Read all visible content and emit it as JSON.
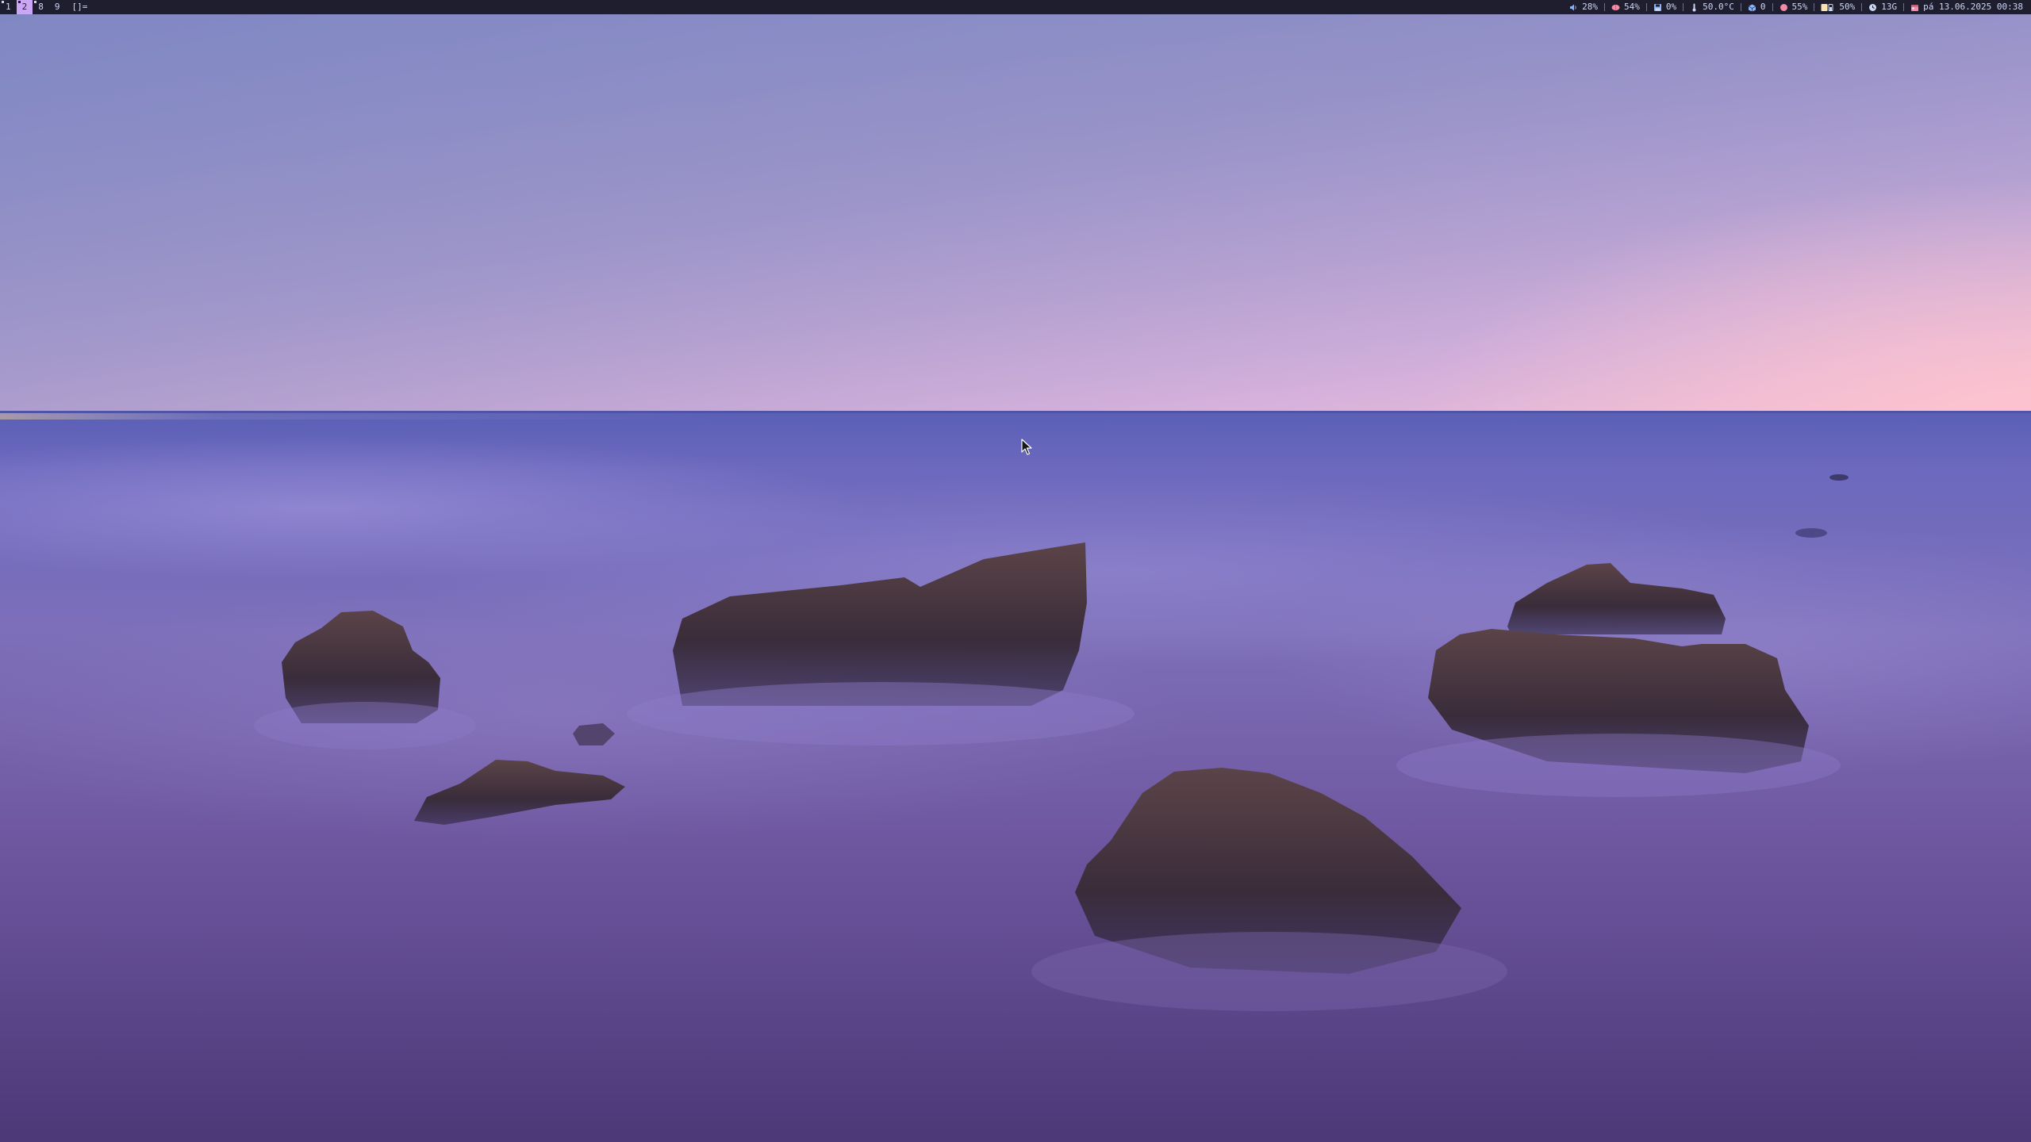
{
  "bar": {
    "tags": [
      {
        "label": "1",
        "active": false,
        "occupied": true
      },
      {
        "label": "2",
        "active": true,
        "occupied": true
      },
      {
        "label": "8",
        "active": false,
        "occupied": true
      },
      {
        "label": "9",
        "active": false,
        "occupied": false
      }
    ],
    "layout_symbol": "[]=",
    "status": {
      "volume": {
        "icon": "speaker-icon",
        "value": "28%",
        "color": "#89b4fa"
      },
      "memory": {
        "icon": "brain-icon",
        "value": "54%",
        "color": "#f38ba8"
      },
      "disk": {
        "icon": "disk-icon",
        "value": "0%",
        "color": "#89b4fa"
      },
      "temperature": {
        "icon": "thermometer-icon",
        "value": "50.0°C",
        "color": "#cdd6f4"
      },
      "updates": {
        "icon": "package-icon",
        "value": "0",
        "color": "#89b4fa"
      },
      "cpu": {
        "icon": "cpu-dot-icon",
        "value": "55%",
        "color": "#f38ba8"
      },
      "battery": {
        "icon": "battery-icon",
        "value": "50%",
        "color": "#f9e2af"
      },
      "swap": {
        "icon": "swap-clock-icon",
        "value": "13G",
        "color": "#cdd6f4"
      },
      "datetime": {
        "icon": "calendar-icon",
        "value": "pá 13.06.2025 00:38",
        "color": "#f38ba8"
      }
    }
  },
  "colors": {
    "bar_bg": "#1e1e2e",
    "bar_fg": "#cdd6f4",
    "accent": "#cba6f7"
  }
}
